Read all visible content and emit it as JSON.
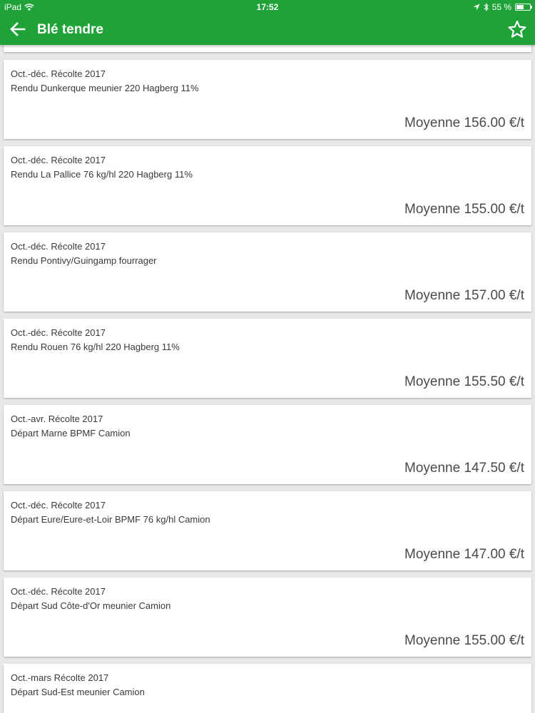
{
  "status_bar": {
    "device": "iPad",
    "time": "17:52",
    "battery": "55 %",
    "battery_level": 0.55
  },
  "app_bar": {
    "title": "Blé tendre",
    "back_icon": "arrow-left-icon",
    "favorite_icon": "star-outline-icon"
  },
  "colors": {
    "brand_green": "#1fa339"
  },
  "items": [
    {
      "period": "",
      "desc": "",
      "avg": ""
    },
    {
      "period": "Oct.-déc. Récolte 2017",
      "desc": "Rendu Dunkerque meunier 220 Hagberg 11%",
      "avg": "Moyenne 156.00 €/t"
    },
    {
      "period": "Oct.-déc. Récolte 2017",
      "desc": "Rendu La Pallice 76 kg/hl 220 Hagberg 11%",
      "avg": "Moyenne 155.00 €/t"
    },
    {
      "period": "Oct.-déc. Récolte 2017",
      "desc": "Rendu Pontivy/Guingamp fourrager",
      "avg": "Moyenne 157.00 €/t"
    },
    {
      "period": "Oct.-déc. Récolte 2017",
      "desc": "Rendu Rouen 76 kg/hl 220 Hagberg 11%",
      "avg": "Moyenne 155.50 €/t"
    },
    {
      "period": "Oct.-avr. Récolte 2017",
      "desc": "Départ Marne BPMF Camion",
      "avg": "Moyenne 147.50 €/t"
    },
    {
      "period": "Oct.-déc. Récolte 2017",
      "desc": "Départ Eure/Eure-et-Loir BPMF 76 kg/hl Camion",
      "avg": "Moyenne 147.00 €/t"
    },
    {
      "period": "Oct.-déc. Récolte 2017",
      "desc": "Départ Sud Côte-d'Or meunier Camion",
      "avg": "Moyenne 155.00 €/t"
    },
    {
      "period": "Oct.-mars Récolte 2017",
      "desc": "Départ Sud-Est meunier Camion",
      "avg": ""
    }
  ]
}
